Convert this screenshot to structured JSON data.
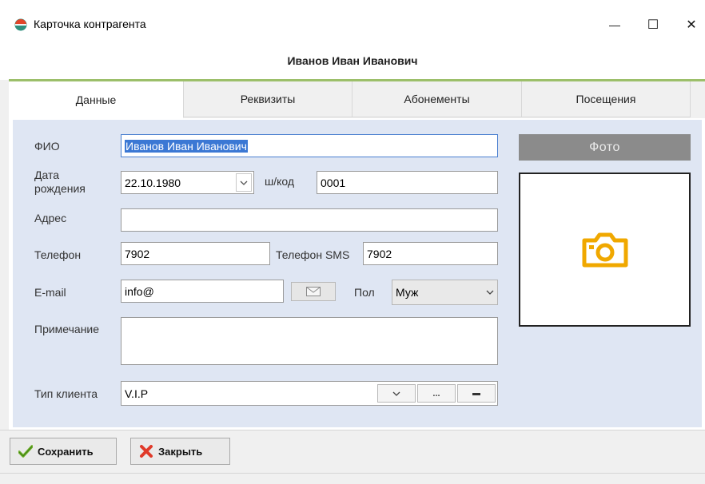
{
  "window": {
    "title": "Карточка контрагента",
    "minimize": "—",
    "maximize": "☐",
    "close": "✕"
  },
  "header": {
    "client_name": "Иванов Иван Иванович"
  },
  "tabs": [
    {
      "label": "Данные",
      "active": true
    },
    {
      "label": "Реквизиты",
      "active": false
    },
    {
      "label": "Абонементы",
      "active": false
    },
    {
      "label": "Посещения",
      "active": false
    }
  ],
  "form": {
    "fio_label": "ФИО",
    "fio_value": "Иванов Иван Иванович",
    "birth_label_1": "Дата",
    "birth_label_2": "рождения",
    "birth_value": "22.10.1980",
    "barcode_label": "ш/код",
    "barcode_value": "0001",
    "address_label": "Адрес",
    "address_value": "",
    "phone_label": "Телефон",
    "phone_value": "7902",
    "sms_label": "Телефон SMS",
    "sms_value": "7902",
    "email_label": "E-mail",
    "email_value": "info@",
    "gender_label": "Пол",
    "gender_value": "Муж",
    "note_label": "Примечание",
    "note_value": "",
    "client_type_label": "Тип клиента",
    "client_type_value": "V.I.P",
    "ellipsis": "...",
    "minus": "▬"
  },
  "photo": {
    "label": "Фото",
    "icon_color": "#f0a800"
  },
  "footer": {
    "save_label": "Сохранить",
    "close_label": "Закрыть"
  }
}
